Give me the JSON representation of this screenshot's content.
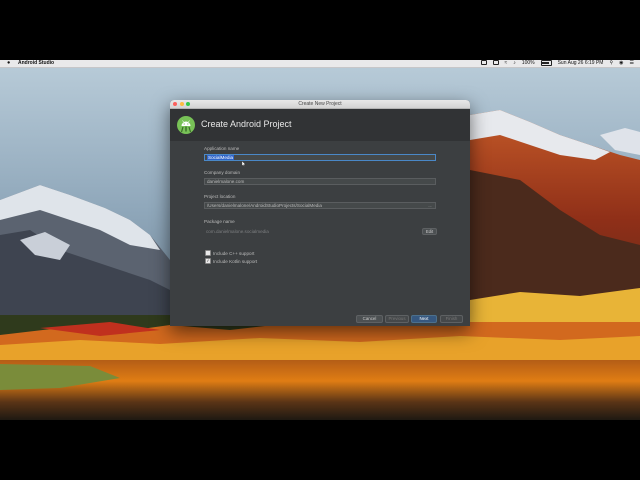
{
  "menubar": {
    "app_name": "Android Studio",
    "battery": "100%",
    "datetime": "Sun Aug 26  6:19 PM"
  },
  "dialog": {
    "window_title": "Create New Project",
    "header_title": "Create Android Project",
    "fields": {
      "application_name": {
        "label": "Application name",
        "value": "SocialMedia"
      },
      "company_domain": {
        "label": "Company domain",
        "value": "danielmalone.com"
      },
      "project_location": {
        "label": "Project location",
        "value": "/Users/danielmalone/AndroidStudioProjects/SocialMedia",
        "browse": "..."
      },
      "package_name": {
        "label": "Package name",
        "value": "com.danielmalone.socialmedia",
        "edit_label": "Edit"
      }
    },
    "checkboxes": [
      {
        "label": "Include C++ support",
        "checked": false
      },
      {
        "label": "Include Kotlin support",
        "checked": true
      }
    ],
    "buttons": {
      "cancel": "Cancel",
      "previous": "Previous",
      "next": "Next",
      "finish": "Finish"
    }
  },
  "colors": {
    "dialog_bg": "#3c3f41",
    "header_bg": "#313335",
    "primary_button": "#365880",
    "selection": "#2f65ca",
    "android_green": "#78c257"
  }
}
